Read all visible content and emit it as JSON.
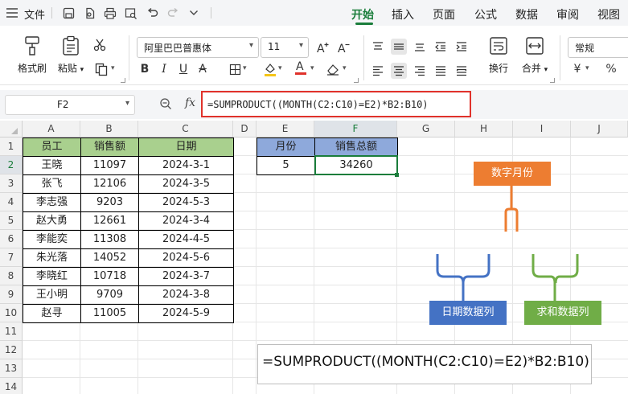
{
  "menubar": {
    "file_label": "文件",
    "tabs": [
      "开始",
      "插入",
      "页面",
      "公式",
      "数据",
      "审阅",
      "视图"
    ],
    "active_tab": "开始",
    "accent": "#1a7d3b"
  },
  "ribbon": {
    "format_painter": "格式刷",
    "paste": "粘贴",
    "font_name": "阿里巴巴普惠体",
    "font_size": "11",
    "wrap": "换行",
    "merge": "合并",
    "number_format": "常规",
    "currency_symbol": "¥",
    "percent_symbol": "%",
    "font_color": "#e0322b",
    "fill_color": "#f5c518"
  },
  "formula_bar": {
    "cell_ref": "F2",
    "fx": "fx",
    "formula": "=SUMPRODUCT((MONTH(C2:C10)=E2)*B2:B10)",
    "highlight_color": "#e0322b"
  },
  "sheet": {
    "columns": [
      "A",
      "B",
      "C",
      "D",
      "E",
      "F",
      "G",
      "H",
      "I",
      "J"
    ],
    "rows": [
      "1",
      "2",
      "3",
      "4",
      "5",
      "6",
      "7",
      "8",
      "9",
      "10",
      "11",
      "12",
      "13",
      "14"
    ],
    "active_col": "F",
    "active_row": "2",
    "table_headers": [
      "员工",
      "销售额",
      "日期"
    ],
    "table_rows": [
      [
        "王晓",
        "11097",
        "2024-3-1"
      ],
      [
        "张飞",
        "12106",
        "2024-3-5"
      ],
      [
        "李志强",
        "9203",
        "2024-5-3"
      ],
      [
        "赵大勇",
        "12661",
        "2024-3-4"
      ],
      [
        "李能奕",
        "11308",
        "2024-4-5"
      ],
      [
        "朱光落",
        "14052",
        "2024-5-6"
      ],
      [
        "李晓红",
        "10718",
        "2024-3-7"
      ],
      [
        "王小明",
        "9709",
        "2024-3-8"
      ],
      [
        "赵寻",
        "11005",
        "2024-5-9"
      ]
    ],
    "summary_headers": [
      "月份",
      "销售总额"
    ],
    "summary_values": [
      "5",
      "34260"
    ],
    "table_header_color": "#a9d08e",
    "summary_header_color": "#8ea9db"
  },
  "annotations": {
    "formula": "=SUMPRODUCT((MONTH(C2:C10)=E2)*B2:B10)",
    "month_label": "数字月份",
    "date_label": "日期数据列",
    "sum_label": "求和数据列",
    "month_color": "#ed7d31",
    "date_color": "#4472c4",
    "sum_color": "#70ad47"
  }
}
